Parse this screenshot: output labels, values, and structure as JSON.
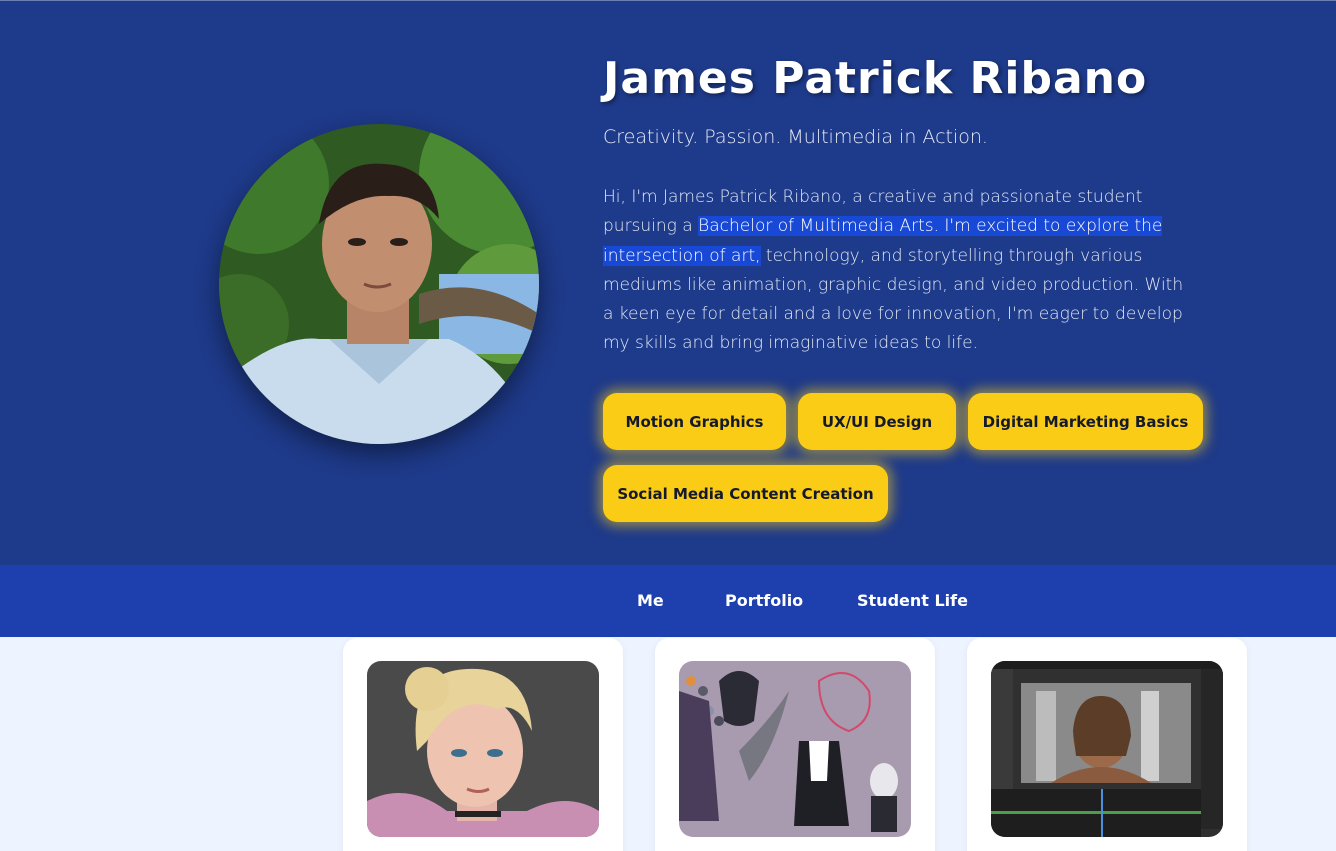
{
  "profile": {
    "name": "James Patrick Ribano",
    "tagline": "Creativity. Passion. Multimedia in Action.",
    "bio_before": "Hi, I'm James Patrick Ribano, a creative and passionate student pursuing a ",
    "bio_highlight": "Bachelor of Multimedia Arts. I'm excited to explore the intersection of art,",
    "bio_after": " technology, and storytelling through various mediums like animation, graphic design, and video production. With a keen eye for detail and a love for innovation, I'm eager to develop my skills and bring imaginative ideas to life."
  },
  "skills": [
    "Motion Graphics",
    "UX/UI Design",
    "Digital Marketing Basics",
    "Social Media Content Creation"
  ],
  "nav": {
    "items": [
      "Me",
      "Portfolio",
      "Student Life"
    ]
  },
  "portfolio": {
    "items": [
      {
        "icon": "3d-character-render-thumbnail"
      },
      {
        "icon": "character-design-sheet-thumbnail"
      },
      {
        "icon": "animation-software-screenshot-thumbnail"
      }
    ]
  },
  "colors": {
    "hero_bg": "#1e3a8a",
    "nav_bg": "#1e40af",
    "skill_bg": "#facc15",
    "page_bg": "#eef4ff",
    "highlight": "#1849d6"
  }
}
